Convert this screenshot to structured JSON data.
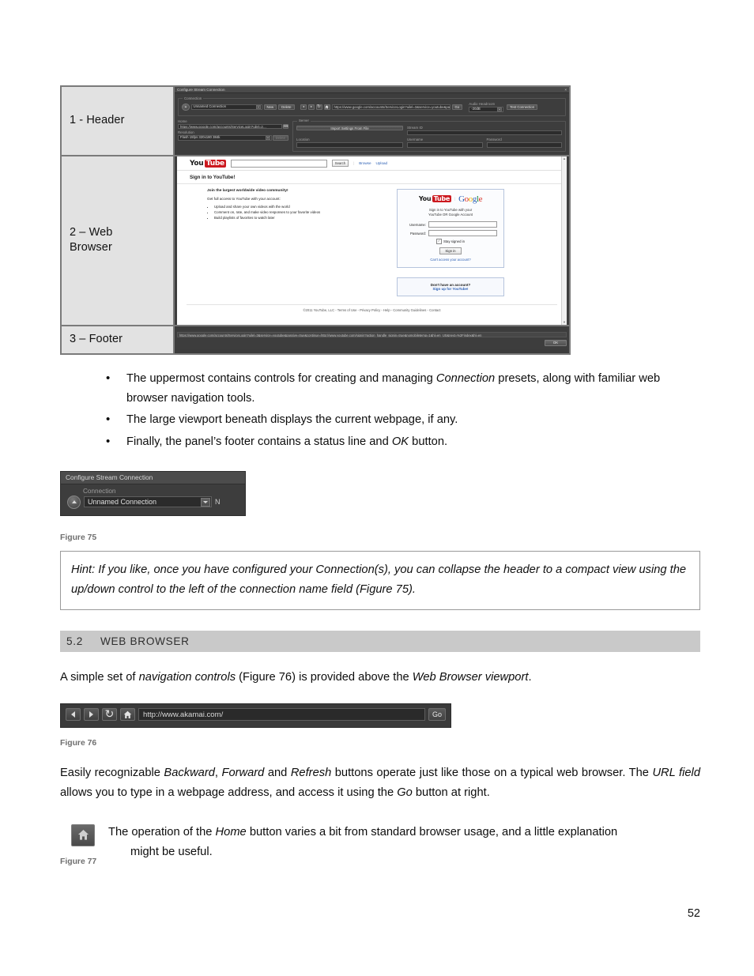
{
  "page": {
    "number": "52"
  },
  "figure74": {
    "labels": [
      {
        "text": "1 - Header"
      },
      {
        "text_line1": "2 – Web",
        "text_line2": "Browser"
      },
      {
        "text": "3 – Footer"
      }
    ],
    "header_panel": {
      "title": "Configure Stream Connection",
      "close_icon": "×",
      "connection_group_caption": "Connection",
      "connection_name": "Unnamed Connection",
      "new_button": "New",
      "delete_button": "Delete",
      "back_icon": "back-arrow",
      "forward_icon": "forward-arrow",
      "refresh_icon": "refresh-arrow",
      "home_icon": "home",
      "url_value": "https://www.google.com/accounts/ServiceLogin?uilel=3&service=youtube&passive=tr",
      "go_button": "Go",
      "audio_headroom_label": "Audio Headroom",
      "audio_headroom_value": "-20dB",
      "test_connection_button": "Test Connection",
      "home_label": "Home",
      "home_value": "https://www.google.com/accounts/ServiceLogin?uilel=2…",
      "home_pick_icon": "folder",
      "resolution_label": "Resolution",
      "resolution_value": "Flash 15fps 320x180 384k",
      "resolution_delete_button": "Delete",
      "server_group_caption": "Server",
      "import_settings_button": "Import Settings From File",
      "location_label": "Location",
      "location_value": "",
      "stream_id_label": "Stream ID",
      "stream_id_value": "",
      "username_label": "Username",
      "username_value": "",
      "password_label": "Password",
      "password_value": ""
    },
    "browser_viewport": {
      "logo_you": "You",
      "logo_tube": "Tube",
      "search_value": "",
      "search_button": "Search",
      "browse_link": "Browse",
      "upload_link": "Upload",
      "heading": "Sign in to YouTube!",
      "join_heading": "Join the largest worldwide video community!",
      "get_full_access": "Get full access to YouTube with your account:",
      "benefits": [
        "Upload and share your own videos with the world",
        "Comment on, rate, and make video responses to your favorite videos",
        "Build playlists of favorites to watch later"
      ],
      "signin_box": {
        "logo_you": "You",
        "logo_tube": "Tube",
        "google_logo": "Google",
        "subtitle_line1": "Sign in to YouTube with your",
        "subtitle_line2": "YouTube OR Google Account",
        "username_label": "Username:",
        "username_value": "",
        "password_label": "Password:",
        "password_value": "",
        "stay_signed_in_label": "Stay signed in",
        "stay_signed_in_checked": "✓",
        "signin_button": "Sign in",
        "cant_access_link": "Can't access your account?"
      },
      "signup_box": {
        "line1": "Don't have an account?",
        "line2": "Sign up for YouTube!"
      },
      "footer": "©2011 YouTube, LLC - Terms of Use - Privacy Policy - Help - Community Guidelines - Contact"
    },
    "footer_panel": {
      "status_text": "https://www.google.com/accounts/ServiceLogin?uilel=3&service=youtube&passive=true&continue=http://www.youtube.com/signin?action_handle_signin=true&nomobiletemp=1&hl=en_US&next=%2Findex&hl=en",
      "ok_button": "OK"
    }
  },
  "bullets": [
    {
      "p1": "The uppermost contains controls for creating and managing ",
      "em1": "Connection",
      "p2": " presets, along with familiar web browser navigation tools."
    },
    {
      "p1": "The large viewport beneath displays the current webpage, if any.",
      "em1": "",
      "p2": ""
    },
    {
      "p1": "Finally, the panel’s footer contains a status line and ",
      "em1": "OK",
      "p2": " button."
    }
  ],
  "figure75": {
    "title": "Configure Stream Connection",
    "connection_caption": "Connection",
    "collapse_icon": "chevron-up",
    "connection_name": "Unnamed Connection",
    "dropdown_icon": "chevron-down",
    "partial_next": "N",
    "caption": "Figure 75"
  },
  "hint": {
    "line1": "Hint: If you like, once you have configured your Connection(s), you can collapse the header to a compact view",
    "line2": "using the up/down control to the left of the connection name field (Figure 75)."
  },
  "section": {
    "number": "5.2",
    "title": "WEB BROWSER"
  },
  "paragraph_nav": {
    "t1": "A simple set of ",
    "em1": "navigation controls",
    "t2": " (Figure 76) is provided above the ",
    "em2": "Web Browser viewport",
    "t3": "."
  },
  "figure76": {
    "back_icon": "back-arrow",
    "forward_icon": "forward-arrow",
    "refresh_icon": "refresh-arrow",
    "home_icon": "home",
    "url_value": "http://www.akamai.com/",
    "go_button": "Go",
    "caption": "Figure 76"
  },
  "paragraph_buttons": {
    "t1": "Easily recognizable ",
    "em1": "Backward",
    "t2": ", ",
    "em2": "Forward",
    "t3": " and ",
    "em3": "Refresh",
    "t4": " buttons operate just like those on a typical web browser. The ",
    "em4": "URL field",
    "t5": " allows you to type in a webpage address, and access it using the ",
    "em5": "Go",
    "t6": " button at right."
  },
  "figure77": {
    "home_icon": "home",
    "caption": "Figure 77",
    "t1": "The operation of the ",
    "em1": "Home",
    "t2": " button varies a bit from standard browser usage, and a little explanation",
    "t3": "might be useful."
  }
}
